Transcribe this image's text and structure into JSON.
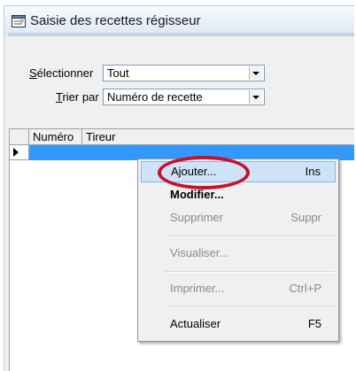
{
  "window": {
    "title": "Saisie des recettes régisseur",
    "icon": "form-window-icon"
  },
  "filters": {
    "select_label_prefix": "S",
    "select_label_rest": "électionner",
    "select_value": "Tout",
    "sort_label_prefix": "T",
    "sort_label_rest": "rier par",
    "sort_value": "Numéro de recette"
  },
  "grid": {
    "columns": [
      "Numéro",
      "Tireur"
    ],
    "selected_row_color": "#3399ff"
  },
  "context_menu": {
    "items": [
      {
        "label": "Ajouter...",
        "shortcut": "Ins",
        "state": "highlighted"
      },
      {
        "label": "Modifier...",
        "shortcut": "",
        "state": "bold"
      },
      {
        "label": "Supprimer",
        "shortcut": "Suppr",
        "state": "disabled"
      },
      {
        "label": "Visualiser...",
        "shortcut": "",
        "state": "disabled"
      },
      {
        "label": "Imprimer...",
        "shortcut": "Ctrl+P",
        "state": "disabled"
      },
      {
        "label": "Actualiser",
        "shortcut": "F5",
        "state": "enabled"
      }
    ]
  },
  "annotation": {
    "color": "#c9102a",
    "shape": "ellipse"
  }
}
